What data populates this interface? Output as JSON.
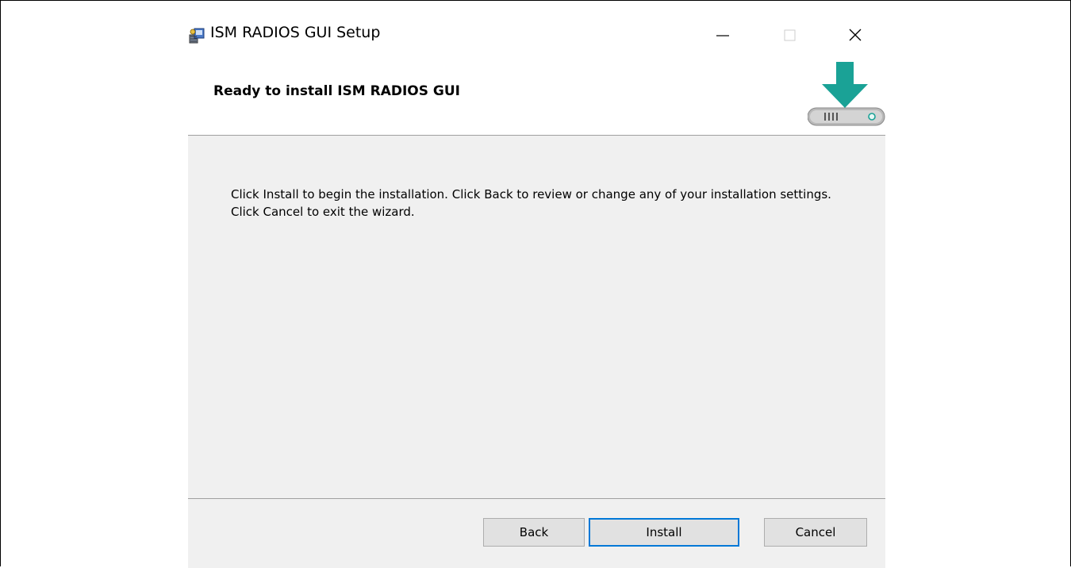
{
  "window": {
    "title": "ISM RADIOS GUI Setup",
    "icon": "installer-icon",
    "controls": [
      "minimize-icon",
      "maximize-icon",
      "close-icon"
    ]
  },
  "header": {
    "title": "Ready to install ISM RADIOS GUI",
    "graphic": "drive-download-icon",
    "accent_color": "#1aa296"
  },
  "content": {
    "message": "Click Install to begin the installation. Click Back to review or change any of your installation settings. Click Cancel to exit the wizard."
  },
  "footer": {
    "back_label": "Back",
    "install_label": "Install",
    "cancel_label": "Cancel",
    "default_button_border": "#0078d7"
  }
}
